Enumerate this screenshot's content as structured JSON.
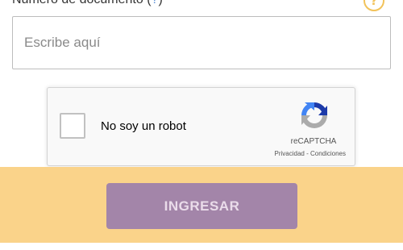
{
  "form": {
    "label_text": "Número de documento",
    "label_paren_open": "(",
    "label_qmark": "?",
    "label_paren_close": ")",
    "help_icon": "?",
    "input_value": "",
    "input_placeholder": "Escribe aquí"
  },
  "recaptcha": {
    "label": "No soy un robot",
    "brand": "reCAPTCHA",
    "privacy_link": "Privacidad",
    "separator": " - ",
    "terms_link": "Condiciones",
    "checked": false,
    "logo_icon": "recaptcha-logo-icon"
  },
  "submit": {
    "label": "INGRESAR"
  },
  "colors": {
    "band": "#fad38a",
    "button_bg": "#a385a9",
    "button_text": "#eadcea",
    "help_icon": "#f2c35b",
    "link_qmark": "#5b8fd6"
  }
}
